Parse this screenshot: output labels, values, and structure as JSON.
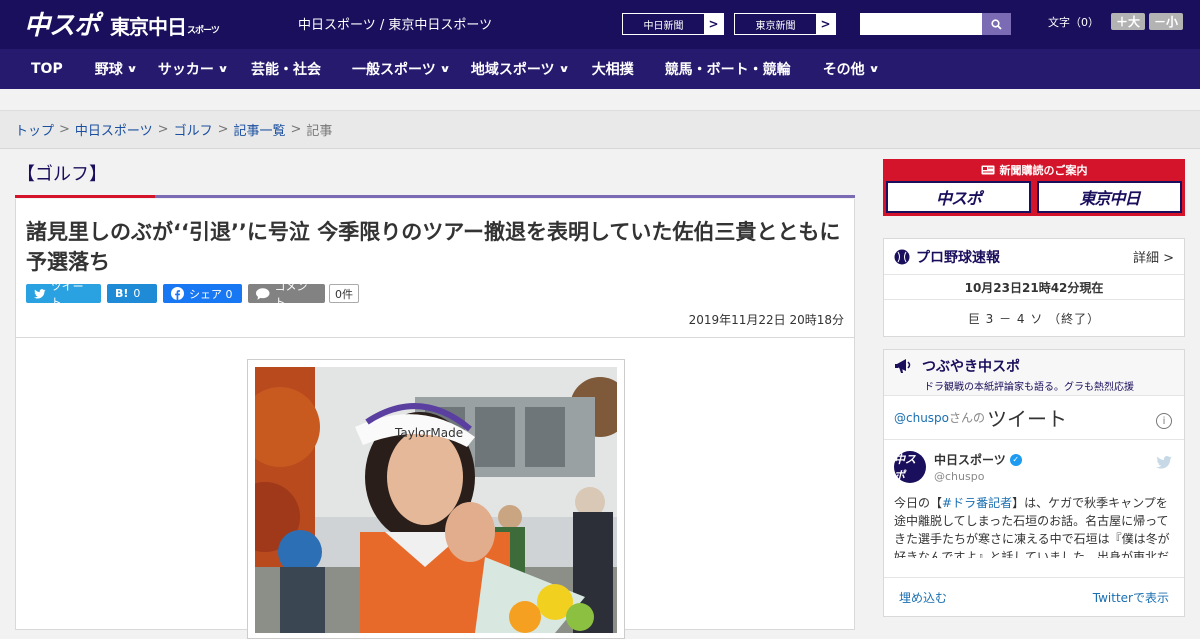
{
  "header": {
    "logo_main": "中スポ",
    "logo_tokyo": "東京中日",
    "logo_tokyo_small": "スポーツ",
    "site_title": "中日スポーツ / 東京中日スポーツ",
    "link_chunichi": "中日新聞",
    "link_tokyo": "東京新聞",
    "arrow": ">",
    "search_placeholder": "",
    "font_label": "文字（0）",
    "font_up": "＋大",
    "font_down": "－小"
  },
  "nav": {
    "items": [
      {
        "label": "TOP",
        "dropdown": false
      },
      {
        "label": "野球",
        "dropdown": true
      },
      {
        "label": "サッカー",
        "dropdown": true
      },
      {
        "label": "芸能・社会",
        "dropdown": false
      },
      {
        "label": "一般スポーツ",
        "dropdown": true
      },
      {
        "label": "地域スポーツ",
        "dropdown": true
      },
      {
        "label": "大相撲",
        "dropdown": false
      },
      {
        "label": "競馬・ボート・競輪",
        "dropdown": false
      },
      {
        "label": "その他",
        "dropdown": true
      }
    ],
    "chevron": "∨"
  },
  "breadcrumb": {
    "items": [
      "トップ",
      "中日スポーツ",
      "ゴルフ",
      "記事一覧"
    ],
    "current": "記事",
    "separator": ">"
  },
  "article": {
    "category": "【ゴルフ】",
    "headline": "諸見里しのぶが‘‘引退’’に号泣 今季限りのツアー撤退を表明していた佐伯三貴とともに予選落ち",
    "date": "2019年11月22日 20時18分",
    "share": {
      "tweet": "ツイート",
      "hatena_icon": "B!",
      "hatena_count": "0",
      "facebook": "シェア 0",
      "comment": "コメント",
      "comment_count": "0件"
    }
  },
  "sidebar": {
    "ad_title": "新聞購読のご案内",
    "ad_chuspo": "中スポ",
    "ad_tokyo": "東京中日",
    "pro_baseball": {
      "title": "プロ野球速報",
      "more": "詳細 >",
      "date": "10月23日21時42分現在",
      "score": "巨 3 － 4 ソ （終了）"
    },
    "tweets": {
      "title": "つぶやき中スポ",
      "subtitle": "ドラ観戦の本紙評論家も語る。グラも熱烈応援",
      "handle_prefix": "@chuspo",
      "handle_suffix": "さんの",
      "timeline_word": "ツイート",
      "info": "i",
      "user_name": "中日スポーツ",
      "user_handle": "@chuspo",
      "avatar_text": "中スポ",
      "bird": "🐦",
      "tweet_pre": "今日の【",
      "tweet_tag": "#ドラ番記者",
      "tweet_post": "】は、ケガで秋季キャンプを途中離脱してしまった石垣のお話。名古屋に帰ってきた選手たちが寒さに凍える中で石垣は『僕は冬が好きなんですよ』と話していました。出身が東北だ",
      "embed": "埋め込む",
      "view_on": "Twitterで表示"
    }
  },
  "colors": {
    "header_bg": "#1a0f5c",
    "nav_bg": "#261a6e",
    "accent_red": "#d4142a",
    "accent_purple": "#7b6bb5"
  }
}
